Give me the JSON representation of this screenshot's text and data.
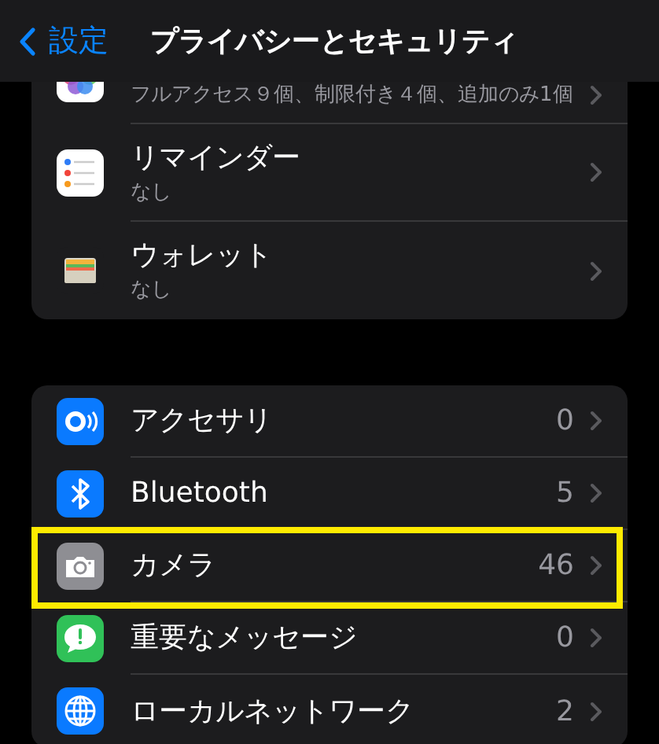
{
  "nav": {
    "back_label": "設定",
    "title": "プライバシーとセキュリティ"
  },
  "groups": [
    {
      "rows": [
        {
          "kind": "double",
          "subtitle": "フルアクセス９個、制限付き４個、追加のみ1個",
          "highlighted": false
        },
        {
          "kind": "double",
          "title": "リマインダー",
          "subtitle": "なし",
          "highlighted": false
        },
        {
          "kind": "double",
          "title": "ウォレット",
          "subtitle": "なし",
          "highlighted": false
        }
      ]
    },
    {
      "rows": [
        {
          "kind": "single",
          "title": "アクセサリ",
          "value": "0",
          "highlighted": false
        },
        {
          "kind": "single",
          "title": "Bluetooth",
          "value": "5",
          "highlighted": false
        },
        {
          "kind": "single",
          "title": "カメラ",
          "value": "46",
          "highlighted": true
        },
        {
          "kind": "single",
          "title": "重要なメッセージ",
          "value": "0",
          "highlighted": false
        },
        {
          "kind": "single",
          "title": "ローカルネットワーク",
          "value": "2",
          "highlighted": false
        }
      ]
    }
  ]
}
